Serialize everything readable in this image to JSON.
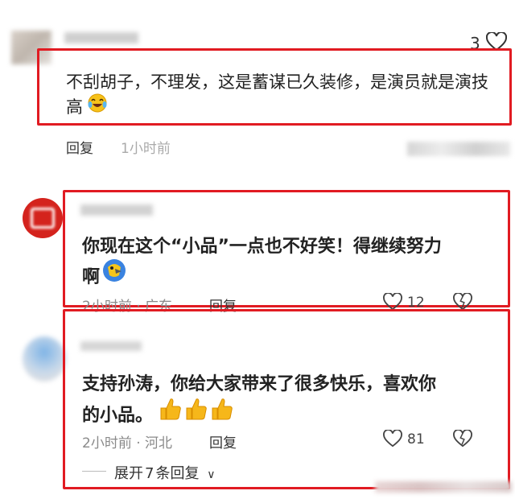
{
  "comment1": {
    "like_count": "3",
    "text_line1": "不刮胡子，不理发，这是蓄谋已久装修，是演员就是演技",
    "text_line2": "高",
    "emoji": "laughing-crying-emoji",
    "reply_label": "回复",
    "time": "1小时前"
  },
  "comment2": {
    "text_line1": "你现在这个“小品”一点也不好笑！得继续努力",
    "text_line2": "啊",
    "emoji": "parrot-emoji",
    "time_location": "2小时前 · 广东",
    "reply_label": "回复",
    "like_count": "12"
  },
  "comment3": {
    "text_line1": "支持孙涛，你给大家带来了很多快乐，喜欢你",
    "text_line2": "的小品。",
    "emoji": "thumbs-up-emoji",
    "time_location": "2小时前 · 河北",
    "reply_label": "回复",
    "like_count": "81",
    "expand_label": "展开",
    "expand_count": "7",
    "expand_suffix": "条回复",
    "expand_chevron": "∨"
  },
  "colors": {
    "highlight_box": "#e11b22",
    "meta_text": "#8a8a8a",
    "body_text": "#222222"
  }
}
